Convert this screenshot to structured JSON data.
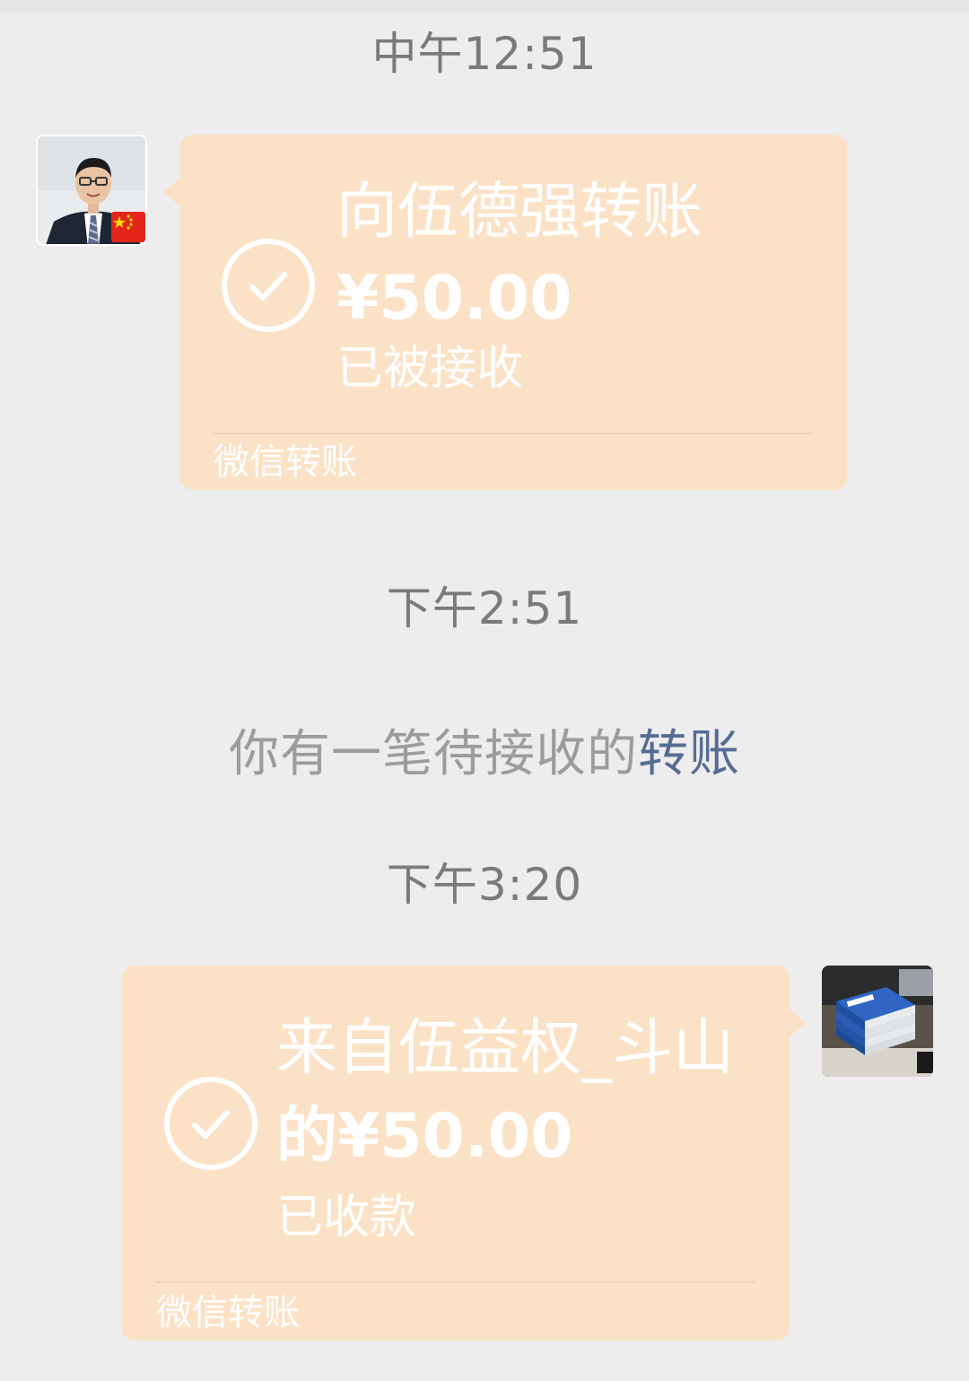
{
  "messages": {
    "time1": "中午12:51",
    "transfer1": {
      "title": "向伍德强转账",
      "amount": "¥50.00",
      "status": "已被接收",
      "footer": "微信转账"
    },
    "time2": "下午2:51",
    "system": {
      "text": "你有一笔待接收的",
      "link": "转账"
    },
    "time3": "下午3:20",
    "transfer2": {
      "title": "来自伍益权_斗山",
      "amount": "的¥50.00",
      "status": "已收款",
      "footer": "微信转账"
    }
  },
  "colors": {
    "background": "#ededed",
    "bubble": "#fbe2c6",
    "link": "#576b95",
    "timestamp": "#7a7a7a"
  },
  "icons": {
    "check": "check-circle-icon",
    "flag": "china-flag-icon"
  }
}
